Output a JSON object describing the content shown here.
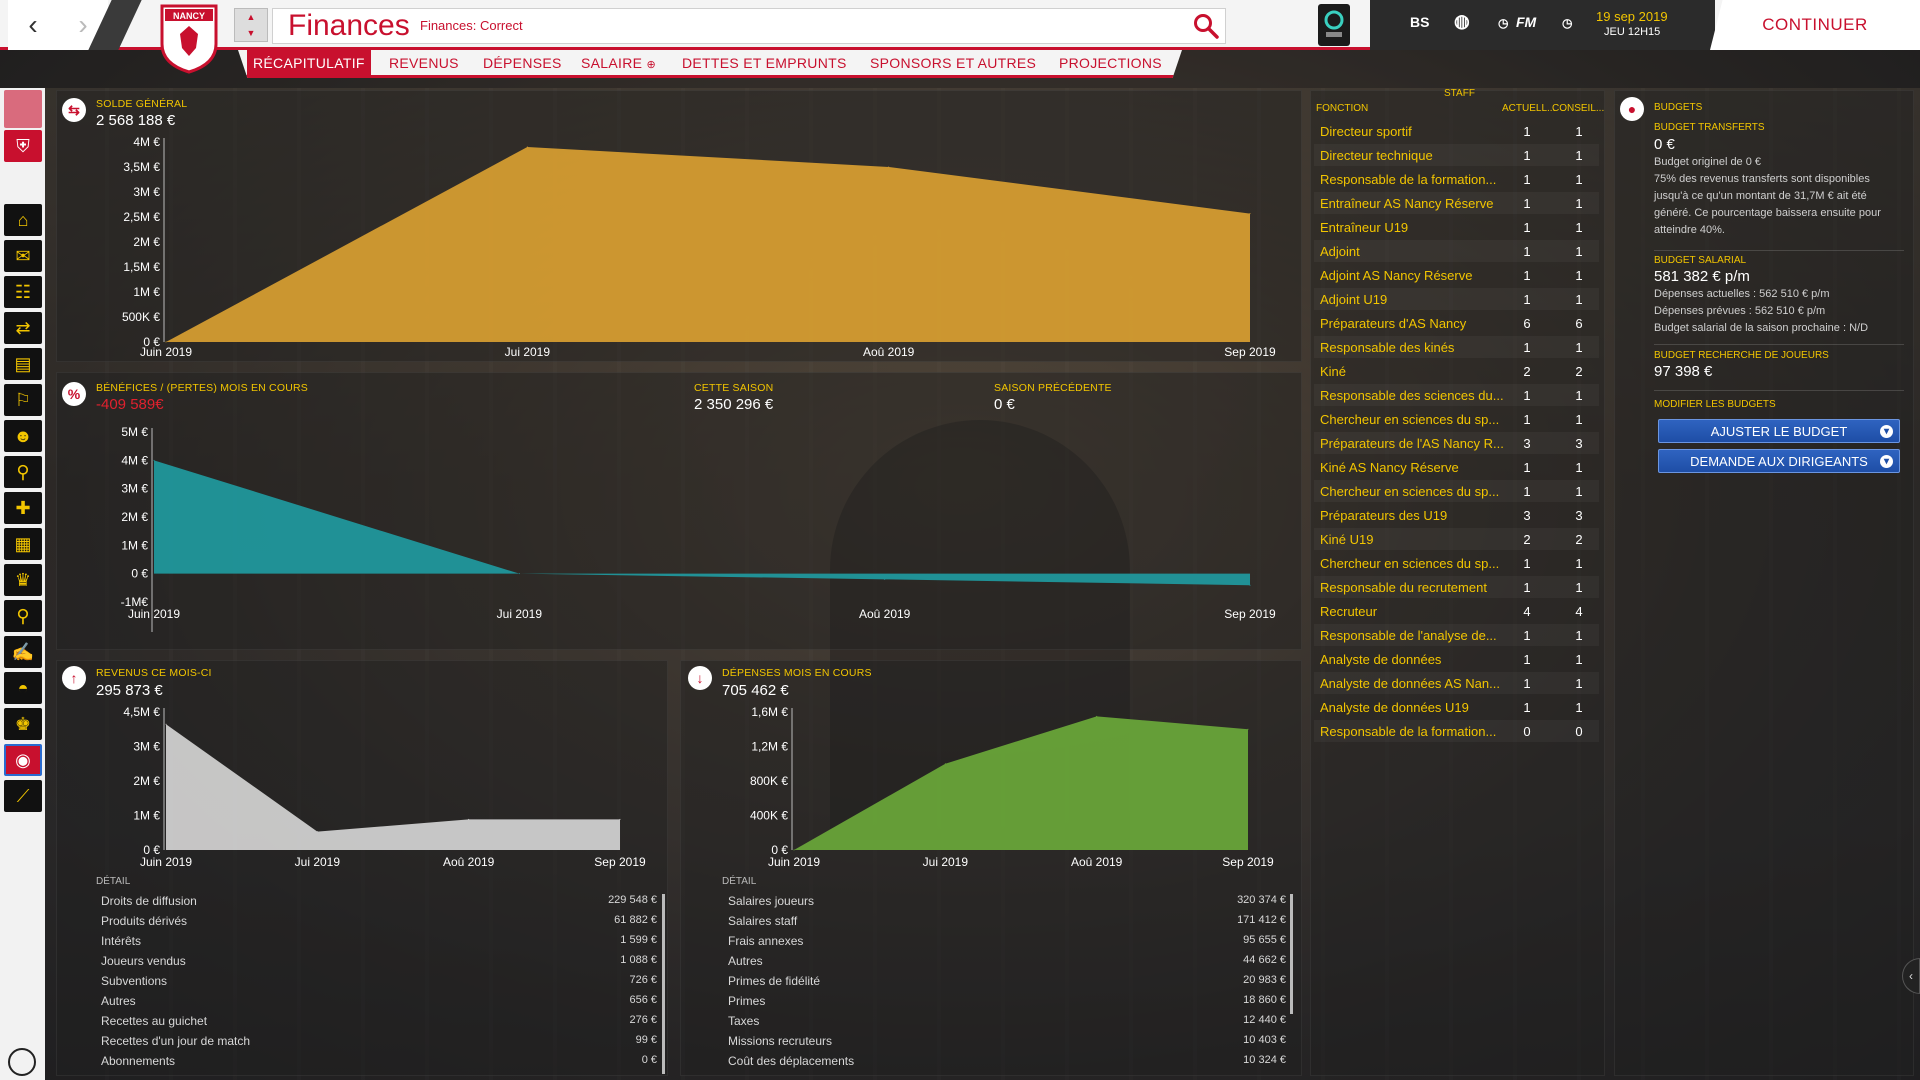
{
  "header": {
    "title": "Finances",
    "subtitle": "Finances: Correct",
    "club_abbrev": "NANCY",
    "manager_initials": "BS",
    "fm_label": "FM",
    "date": "19 sep 2019",
    "time": "JEU 12H15",
    "continue_label": "CONTINUER"
  },
  "tabs": [
    {
      "label": "RÉCAPITULATIF",
      "active": true
    },
    {
      "label": "REVENUS"
    },
    {
      "label": "DÉPENSES"
    },
    {
      "label": "SALAIRE"
    },
    {
      "label": "DETTES ET EMPRUNTS"
    },
    {
      "label": "SPONSORS ET AUTRES"
    },
    {
      "label": "PROJECTIONS"
    }
  ],
  "balance": {
    "label": "SOLDE GÉNÉRAL",
    "value": "2 568 188 €"
  },
  "profit": {
    "label": "BÉNÉFICES / (PERTES) MOIS EN COURS",
    "value": "-409 589€",
    "season_label": "CETTE SAISON",
    "season_value": "2 350 296 €",
    "prev_label": "SAISON PRÉCÉDENTE",
    "prev_value": "0 €"
  },
  "income": {
    "label": "REVENUS CE MOIS-CI",
    "value": "295 873 €",
    "detail_label": "DÉTAIL",
    "rows": [
      {
        "name": "Droits de diffusion",
        "value": "229 548 €"
      },
      {
        "name": "Produits dérivés",
        "value": "61 882 €"
      },
      {
        "name": "Intérêts",
        "value": "1 599 €"
      },
      {
        "name": "Joueurs vendus",
        "value": "1 088 €"
      },
      {
        "name": "Subventions",
        "value": "726 €"
      },
      {
        "name": "Autres",
        "value": "656 €"
      },
      {
        "name": "Recettes au guichet",
        "value": "276 €"
      },
      {
        "name": "Recettes d'un jour de match",
        "value": "99 €"
      },
      {
        "name": "Abonnements",
        "value": "0 €"
      }
    ]
  },
  "expenses": {
    "label": "DÉPENSES MOIS EN COURS",
    "value": "705 462 €",
    "detail_label": "DÉTAIL",
    "rows": [
      {
        "name": "Salaires joueurs",
        "value": "320 374 €"
      },
      {
        "name": "Salaires staff",
        "value": "171 412 €"
      },
      {
        "name": "Frais annexes",
        "value": "95 655 €"
      },
      {
        "name": "Autres",
        "value": "44 662 €"
      },
      {
        "name": "Primes de fidélité",
        "value": "20 983 €"
      },
      {
        "name": "Primes",
        "value": "18 860 €"
      },
      {
        "name": "Taxes",
        "value": "12 440 €"
      },
      {
        "name": "Missions recruteurs",
        "value": "10 403 €"
      },
      {
        "name": "Coût des déplacements",
        "value": "10 324 €"
      }
    ]
  },
  "chart_data": [
    {
      "type": "area",
      "x": [
        "Juin 2019",
        "Jui 2019",
        "Aoû 2019",
        "Sep 2019"
      ],
      "values": [
        0,
        3900000,
        3500000,
        2568188
      ],
      "yticks": [
        "0 €",
        "500K €",
        "1M €",
        "1,5M €",
        "2M €",
        "2,5M €",
        "3M €",
        "3,5M €",
        "4M €"
      ],
      "ylim": [
        0,
        4000000
      ],
      "color": "#d9a031"
    },
    {
      "type": "area",
      "x": [
        "Juin 2019",
        "Jui 2019",
        "Aoû 2019",
        "Sep 2019"
      ],
      "values": [
        4000000,
        0,
        -200000,
        -409589
      ],
      "yticks": [
        "-1M€",
        "0 €",
        "1M €",
        "2M €",
        "3M €",
        "4M €",
        "5M €"
      ],
      "ylim": [
        -1000000,
        5000000
      ],
      "color": "#1f9aa0"
    },
    {
      "type": "area",
      "x": [
        "Juin 2019",
        "Jui 2019",
        "Aoû 2019",
        "Sep 2019"
      ],
      "values": [
        4100000,
        600000,
        1000000,
        1000000
      ],
      "yticks": [
        "0 €",
        "1M €",
        "2M €",
        "3M €",
        "4,5M €"
      ],
      "ylim": [
        0,
        4500000
      ],
      "color": "#d4d4d4"
    },
    {
      "type": "area",
      "x": [
        "Juin 2019",
        "Jui 2019",
        "Aoû 2019",
        "Sep 2019"
      ],
      "values": [
        0,
        1000000,
        1550000,
        1400000
      ],
      "yticks": [
        "0 €",
        "400K €",
        "800K €",
        "1,2M €",
        "1,6M €"
      ],
      "ylim": [
        0,
        1600000
      ],
      "color": "#6aa83a"
    }
  ],
  "staff": {
    "title": "STAFF",
    "col_function": "FONCTION",
    "col_current": "ACTUELL...",
    "col_advised": "CONSEIL...",
    "rows": [
      {
        "name": "Directeur sportif",
        "current": "1",
        "advised": "1"
      },
      {
        "name": "Directeur technique",
        "current": "1",
        "advised": "1"
      },
      {
        "name": "Responsable de la formation...",
        "current": "1",
        "advised": "1"
      },
      {
        "name": "Entraîneur AS Nancy Réserve",
        "current": "1",
        "advised": "1"
      },
      {
        "name": "Entraîneur U19",
        "current": "1",
        "advised": "1"
      },
      {
        "name": "Adjoint",
        "current": "1",
        "advised": "1"
      },
      {
        "name": "Adjoint AS Nancy Réserve",
        "current": "1",
        "advised": "1"
      },
      {
        "name": "Adjoint U19",
        "current": "1",
        "advised": "1"
      },
      {
        "name": "Préparateurs d'AS Nancy",
        "current": "6",
        "advised": "6"
      },
      {
        "name": "Responsable des kinés",
        "current": "1",
        "advised": "1"
      },
      {
        "name": "Kiné",
        "current": "2",
        "advised": "2"
      },
      {
        "name": "Responsable des sciences du...",
        "current": "1",
        "advised": "1"
      },
      {
        "name": "Chercheur en sciences du sp...",
        "current": "1",
        "advised": "1"
      },
      {
        "name": "Préparateurs de l'AS Nancy R...",
        "current": "3",
        "advised": "3"
      },
      {
        "name": "Kiné AS Nancy Réserve",
        "current": "1",
        "advised": "1"
      },
      {
        "name": "Chercheur en sciences du sp...",
        "current": "1",
        "advised": "1"
      },
      {
        "name": "Préparateurs des U19",
        "current": "3",
        "advised": "3"
      },
      {
        "name": "Kiné U19",
        "current": "2",
        "advised": "2"
      },
      {
        "name": "Chercheur en sciences du sp...",
        "current": "1",
        "advised": "1"
      },
      {
        "name": "Responsable du recrutement",
        "current": "1",
        "advised": "1"
      },
      {
        "name": "Recruteur",
        "current": "4",
        "advised": "4"
      },
      {
        "name": "Responsable de l'analyse de...",
        "current": "1",
        "advised": "1"
      },
      {
        "name": "Analyste de données",
        "current": "1",
        "advised": "1"
      },
      {
        "name": "Analyste de données AS Nan...",
        "current": "1",
        "advised": "1"
      },
      {
        "name": "Analyste de données U19",
        "current": "1",
        "advised": "1"
      },
      {
        "name": "Responsable de la formation...",
        "current": "0",
        "advised": "0"
      }
    ]
  },
  "budgets": {
    "title": "BUDGETS",
    "transfer_label": "BUDGET TRANSFERTS",
    "transfer_value": "0 €",
    "transfer_original": "Budget originel de 0 €",
    "transfer_note": "75% des revenus transferts sont disponibles jusqu'à ce qu'un montant de 31,7M € ait été généré. Ce pourcentage baissera ensuite pour atteindre 40%.",
    "wage_label": "BUDGET SALARIAL",
    "wage_value": "581 382 € p/m",
    "wage_current": "Dépenses actuelles : 562 510 € p/m",
    "wage_planned": "Dépenses prévues : 562 510 € p/m",
    "wage_next": "Budget salarial de la saison prochaine : N/D",
    "scout_label": "BUDGET RECHERCHE DE JOUEURS",
    "scout_value": "97 398 €",
    "modify_label": "MODIFIER LES BUDGETS",
    "adjust_button": "AJUSTER LE BUDGET",
    "request_button": "DEMANDE AUX DIRIGEANTS"
  }
}
